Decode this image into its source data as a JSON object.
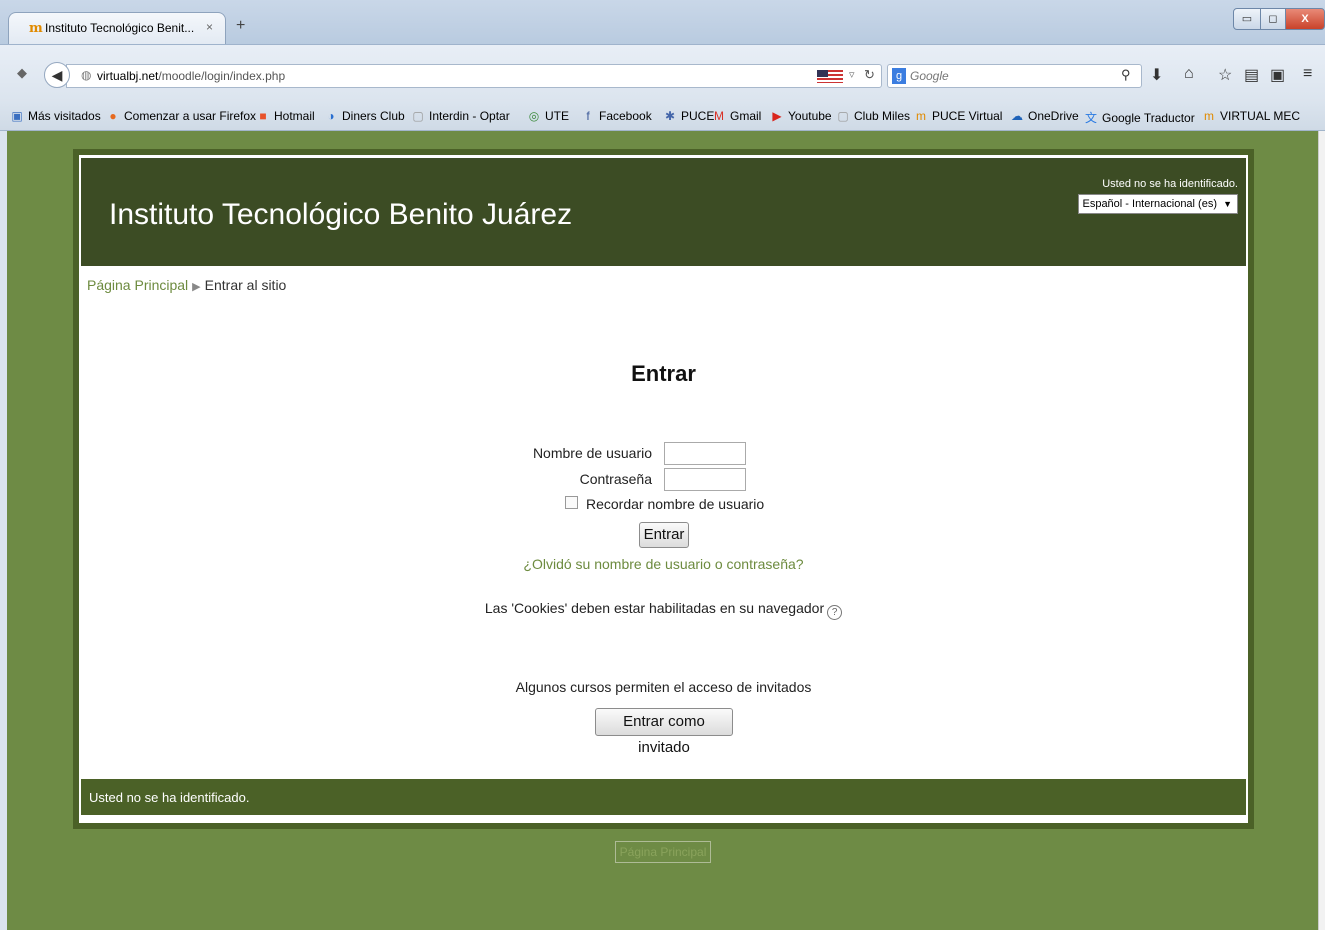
{
  "browser": {
    "tab_title": "Instituto Tecnológico Benit...",
    "tab_close": "×",
    "new_tab": "+",
    "url_domain": "virtualbj.net",
    "url_path": "/moodle/login/index.php",
    "search_placeholder": "Google",
    "window_controls": {
      "minimize": "▭",
      "maximize": "◻",
      "close": "X"
    }
  },
  "bookmarks": [
    {
      "label": "Más visitados",
      "icon": "most-visited-icon",
      "glyph": "▣",
      "color": "#3b6fc0"
    },
    {
      "label": "Comenzar a usar Firefox",
      "icon": "firefox-icon",
      "glyph": "●",
      "color": "#e66a1f"
    },
    {
      "label": "Hotmail",
      "icon": "windows-icon",
      "glyph": "■",
      "color": "#e8522a"
    },
    {
      "label": "Diners Club",
      "icon": "diners-icon",
      "glyph": "◑",
      "color": "#2a6fd0"
    },
    {
      "label": "Interdin - Optar",
      "icon": "blank-page-icon",
      "glyph": "▢",
      "color": "#999999"
    },
    {
      "label": "UTE",
      "icon": "ute-icon",
      "glyph": "◎",
      "color": "#3a8a3a"
    },
    {
      "label": "Facebook",
      "icon": "facebook-icon",
      "glyph": "f",
      "color": "#3b5998"
    },
    {
      "label": "PUCE",
      "icon": "puce-icon",
      "glyph": "✱",
      "color": "#4466aa"
    },
    {
      "label": "Gmail",
      "icon": "gmail-icon",
      "glyph": "M",
      "color": "#d93025"
    },
    {
      "label": "Youtube",
      "icon": "youtube-icon",
      "glyph": "▶",
      "color": "#d9251d"
    },
    {
      "label": "Club Miles",
      "icon": "blank-page-icon",
      "glyph": "▢",
      "color": "#999999"
    },
    {
      "label": "PUCE Virtual",
      "icon": "moodle-icon",
      "glyph": "m",
      "color": "#e08a00"
    },
    {
      "label": "OneDrive",
      "icon": "onedrive-icon",
      "glyph": "☁",
      "color": "#1e62b8"
    },
    {
      "label": "Google Traductor",
      "icon": "translate-icon",
      "glyph": "文",
      "color": "#2a7ae2"
    },
    {
      "label": "VIRTUAL MEC",
      "icon": "moodle-icon",
      "glyph": "m",
      "color": "#e08a00"
    }
  ],
  "site": {
    "title": "Instituto Tecnológico Benito Juárez",
    "not_logged_in": "Usted no se ha identificado.",
    "language": "Español - Internacional (es)"
  },
  "breadcrumb": {
    "home": "Página Principal",
    "separator": "▶",
    "current": "Entrar al sitio"
  },
  "login": {
    "heading": "Entrar",
    "username_label": "Nombre de usuario",
    "password_label": "Contraseña",
    "remember_label": "Recordar nombre de usuario",
    "submit_label": "Entrar",
    "forgot_link": "¿Olvidó su nombre de usuario o contraseña?",
    "cookies_notice": "Las 'Cookies' deben estar habilitadas en su navegador",
    "guest_notice": "Algunos cursos permiten el acceso de invitados",
    "guest_button": "Entrar como invitado"
  },
  "footer": {
    "text": "Usted no se ha identificado.",
    "home_button": "Página Principal"
  },
  "colors": {
    "page_background": "#6e8b45",
    "header_background": "#3c4c24",
    "footer_background": "#4b6127",
    "link": "#6d8b3f"
  }
}
